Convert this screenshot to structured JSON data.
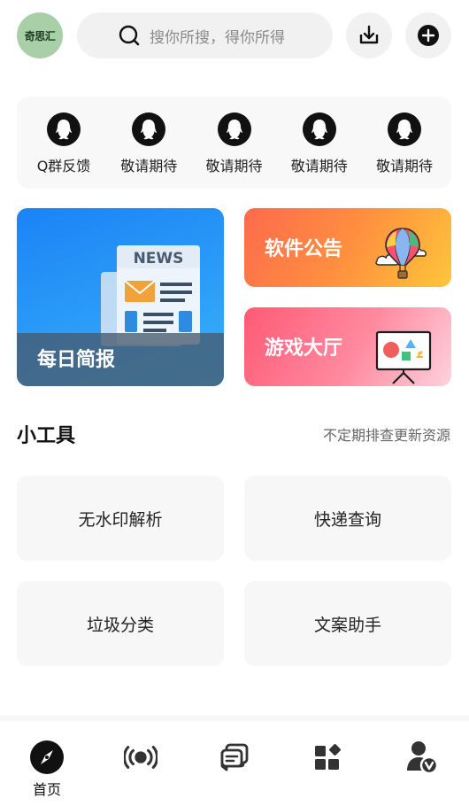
{
  "header": {
    "avatar_text": "奇思汇",
    "search_placeholder": "搜你所搜，得你所得",
    "download_icon": "download-icon",
    "add_icon": "add-circle-icon"
  },
  "qgroups": [
    {
      "label": "Q群反馈",
      "icon": "qq-penguin-icon"
    },
    {
      "label": "敬请期待",
      "icon": "qq-penguin-icon"
    },
    {
      "label": "敬请期待",
      "icon": "qq-penguin-icon"
    },
    {
      "label": "敬请期待",
      "icon": "qq-penguin-icon"
    },
    {
      "label": "敬请期待",
      "icon": "qq-penguin-icon"
    }
  ],
  "tiles": {
    "news": {
      "label": "每日简报",
      "art_text": "NEWS"
    },
    "notice": {
      "label": "软件公告"
    },
    "game": {
      "label": "游戏大厅"
    }
  },
  "tools": {
    "title": "小工具",
    "note": "不定期排查更新资源",
    "items": [
      "无水印解析",
      "快递查询",
      "垃圾分类",
      "文案助手"
    ]
  },
  "nav": {
    "items": [
      {
        "label": "首页",
        "icon": "compass-icon",
        "active": true
      },
      {
        "label": "",
        "icon": "broadcast-icon"
      },
      {
        "label": "",
        "icon": "messages-icon"
      },
      {
        "label": "",
        "icon": "apps-icon"
      },
      {
        "label": "",
        "icon": "user-verified-icon"
      }
    ]
  },
  "colors": {
    "accent_blue": "#1b83f5",
    "accent_orange": "#ff8f3f",
    "accent_pink": "#ff5a74",
    "avatar_green": "#a9cfa8"
  }
}
